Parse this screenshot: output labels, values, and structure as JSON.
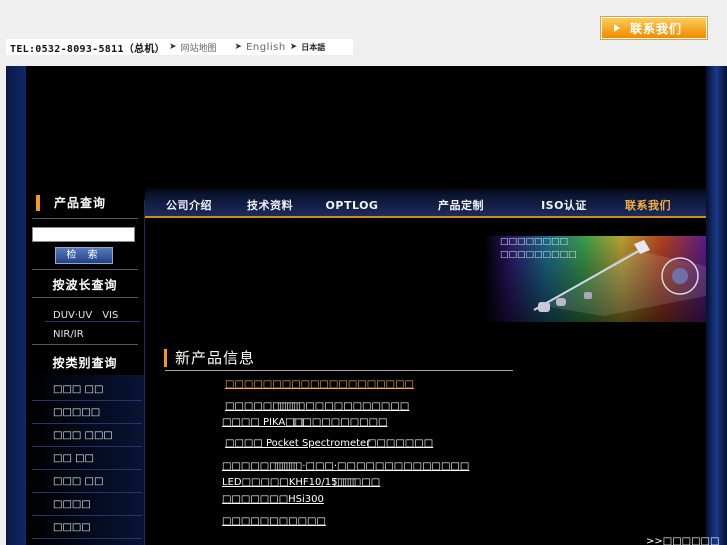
{
  "header": {
    "contact_button": "联系我们",
    "tel": "TEL:0532-8093-5811（总机）",
    "links": [
      "网站地图",
      "English",
      "日本語"
    ]
  },
  "sidebar": {
    "product_search_title": "产品查询",
    "search_input_value": "",
    "search_button": "检 索",
    "by_wavelength_title": "按波长查询",
    "wavelength_items": [
      "DUV·UV　VIS",
      "NIR/IR"
    ],
    "by_category_title": "按类别查询",
    "category_items": [
      "□□□ □□",
      "□□□□□",
      "□□□ □□□",
      "□□ □□",
      "□□□ □□",
      "□□□□",
      "□□□□"
    ]
  },
  "nav": {
    "items": [
      "公司介绍",
      "技术资料",
      "OPTLOG",
      "产品定制",
      "ISO认证",
      "联系我们"
    ]
  },
  "banner": {
    "lines": [
      "□□□□□□□□",
      "□□□□□□□□□"
    ]
  },
  "new_products": {
    "title": "新产品信息",
    "links": [
      "□□□□□□□□□□□□□□□□□□□□",
      "□□□□□□□□",
      "□□□□□□□□□□□□□□",
      "□□□□ PIKA□□",
      "□□□□□□□□□□",
      "□□□□ Pocket Spectrometer",
      "□□□□□□□",
      "□□□□□□□□",
      "□□□·□□□·□□□□□□□□□□□□□□",
      "LED□□□□□KHF10/15□□",
      "□□□□□",
      "□□□□□□□HSi300",
      "□□□□□□□□□□□"
    ],
    "more": ">>□□□□□□"
  },
  "colors": {
    "accent_orange": "#f39a1e",
    "nav_highlight": "#f6b03a",
    "background": "#000000"
  }
}
